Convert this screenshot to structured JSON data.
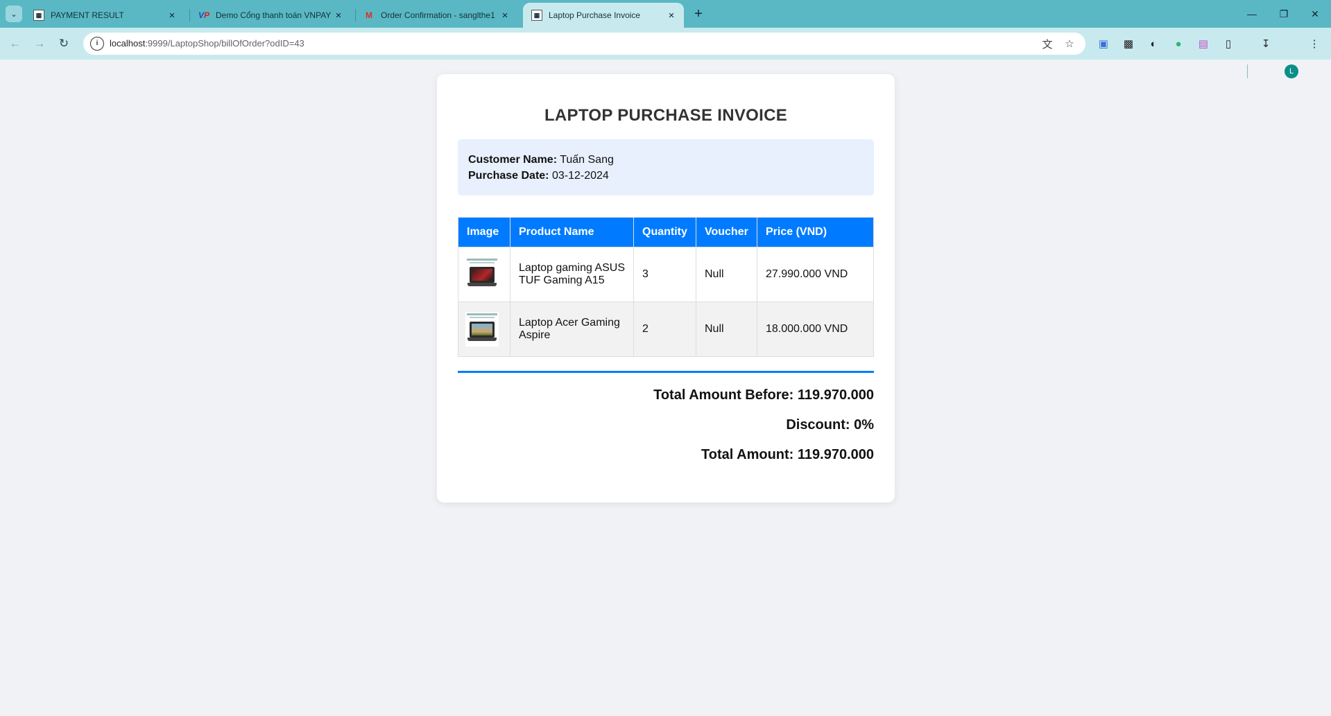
{
  "browser": {
    "tabs": [
      {
        "title": "PAYMENT RESULT",
        "active": false
      },
      {
        "title": "Demo Cổng thanh toán VNPAY",
        "active": false
      },
      {
        "title": "Order Confirmation - sanglthe1",
        "active": false
      },
      {
        "title": "Laptop Purchase Invoice",
        "active": true
      }
    ],
    "url_host": "localhost",
    "url_path": ":9999/LaptopShop/billOfOrder?odID=43",
    "avatar_letter": "L",
    "accent_color": "#5ab8c4"
  },
  "invoice": {
    "title": "LAPTOP PURCHASE INVOICE",
    "customer_label": "Customer Name:",
    "customer_name": "Tuấn Sang",
    "date_label": "Purchase Date:",
    "purchase_date": "03-12-2024",
    "columns": [
      "Image",
      "Product Name",
      "Quantity",
      "Voucher",
      "Price (VND)"
    ],
    "items": [
      {
        "name": "Laptop gaming ASUS TUF Gaming A15",
        "quantity": "3",
        "voucher": "Null",
        "price": "27.990.000 VND"
      },
      {
        "name": "Laptop Acer Gaming Aspire",
        "quantity": "2",
        "voucher": "Null",
        "price": "18.000.000 VND"
      }
    ],
    "total_before": "Total Amount Before: 119.970.000",
    "discount": "Discount: 0%",
    "total": "Total Amount: 119.970.000",
    "header_color": "#007bff"
  }
}
